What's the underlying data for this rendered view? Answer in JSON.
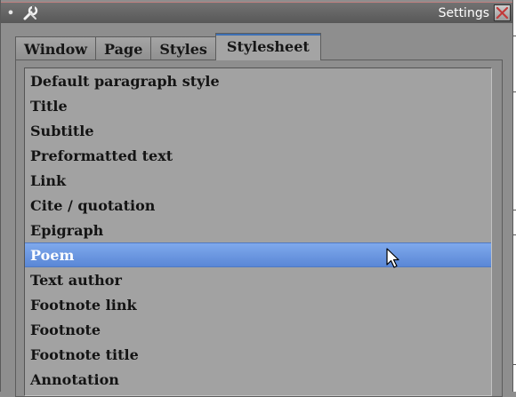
{
  "window": {
    "title": "Settings",
    "left_mark": "•",
    "app_icon": "wrench-screwdriver-icon",
    "close_icon": "close-x-icon"
  },
  "tabs": [
    {
      "label": "Window",
      "active": false
    },
    {
      "label": "Page",
      "active": false
    },
    {
      "label": "Styles",
      "active": false
    },
    {
      "label": "Stylesheet",
      "active": true
    }
  ],
  "stylesheet_list": {
    "items": [
      {
        "label": "Default paragraph style"
      },
      {
        "label": "Title"
      },
      {
        "label": "Subtitle"
      },
      {
        "label": "Preformatted text"
      },
      {
        "label": "Link"
      },
      {
        "label": "Cite / quotation"
      },
      {
        "label": "Epigraph"
      },
      {
        "label": "Poem"
      },
      {
        "label": "Text author"
      },
      {
        "label": "Footnote link"
      },
      {
        "label": "Footnote"
      },
      {
        "label": "Footnote title"
      },
      {
        "label": "Annotation"
      }
    ],
    "selected_label": "Poem"
  },
  "colors": {
    "selection": "#6a97e2",
    "active_tab_accent": "#3d6fb3",
    "window_bg": "#8e8e8e"
  },
  "cursor": "mouse-pointer-icon"
}
